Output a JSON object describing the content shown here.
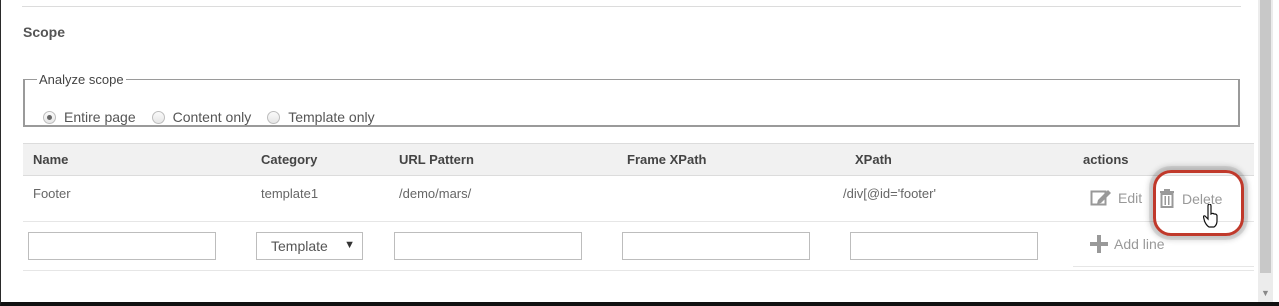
{
  "section": {
    "title": "Scope"
  },
  "analyze_scope": {
    "legend": "Analyze scope",
    "options": [
      {
        "label": "Entire page",
        "checked": true
      },
      {
        "label": "Content only",
        "checked": false
      },
      {
        "label": "Template only",
        "checked": false
      }
    ]
  },
  "table": {
    "headers": [
      "Name",
      "Category",
      "URL Pattern",
      "Frame XPath",
      "XPath",
      "actions"
    ],
    "rows": [
      {
        "name": "Footer",
        "category": "template1",
        "url_pattern": "/demo/mars/",
        "frame_xpath": "",
        "xpath": "/div[@id='footer'"
      }
    ],
    "actions": {
      "edit": "Edit",
      "delete": "Delete",
      "add_line": "Add line"
    },
    "new_row": {
      "name": "",
      "category": "Template",
      "url_pattern": "",
      "frame_xpath": "",
      "xpath": ""
    }
  },
  "colors": {
    "highlight": "#c0392b",
    "header_bg": "#f1f1f1"
  }
}
